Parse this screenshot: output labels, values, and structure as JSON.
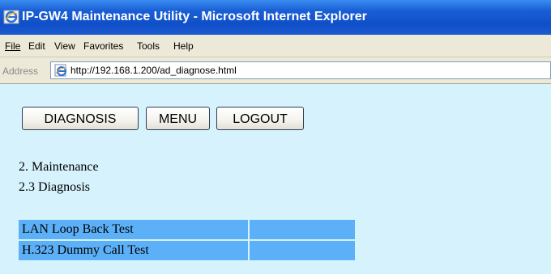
{
  "window": {
    "title": "IP-GW4 Maintenance Utility - Microsoft Internet Explorer",
    "icon": "internet-explorer-icon"
  },
  "menubar": {
    "items": [
      {
        "label": "File"
      },
      {
        "label": "Edit"
      },
      {
        "label": "View"
      },
      {
        "label": "Favorites"
      },
      {
        "label": "Tools"
      },
      {
        "label": "Help"
      }
    ]
  },
  "addressbar": {
    "label": "Address",
    "url": "http://192.168.1.200/ad_diagnose.html",
    "icon": "ie-page-icon"
  },
  "toolbar": {
    "diagnosis_label": "DIAGNOSIS",
    "menu_label": "MENU",
    "logout_label": "LOGOUT"
  },
  "breadcrumb": {
    "section": "2. Maintenance",
    "subsection": "2.3 Diagnosis"
  },
  "tests": [
    {
      "name": "LAN Loop Back Test",
      "value": ""
    },
    {
      "name": "H.323 Dummy Call Test",
      "value": ""
    }
  ],
  "colors": {
    "titlebar": "#0f4fc8",
    "content_bg": "#d6f2fc",
    "table_cell": "#5bb0f8"
  }
}
